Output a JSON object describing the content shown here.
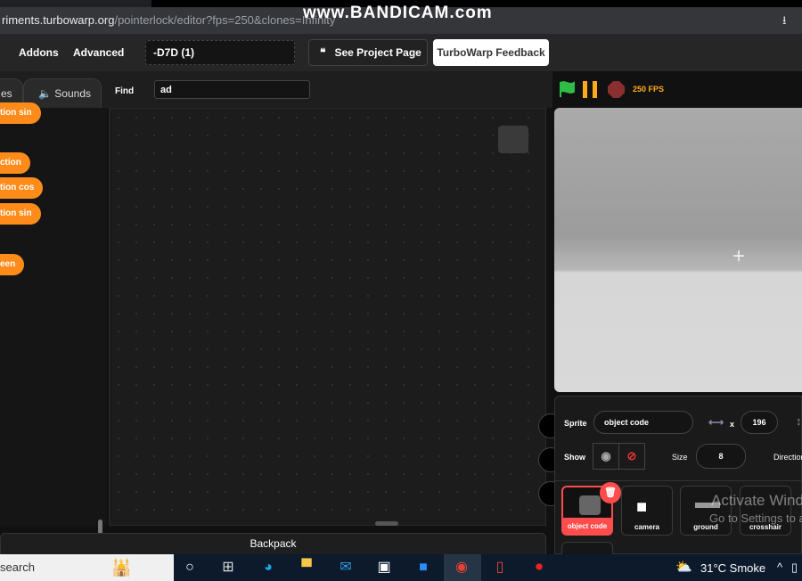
{
  "browser": {
    "url_host": "riments.turbowarp.org",
    "url_path": "/pointerlock/editor?fps=250&clones=Infinity",
    "watermark": "www.BANDICAM.com"
  },
  "menubar": {
    "items": [
      "Addons",
      "Advanced"
    ],
    "project_title": "-D7D (1)",
    "see_project": "See Project Page",
    "feedback": "TurboWarp Feedback"
  },
  "editor_tabs": {
    "costumes": "es",
    "sounds": "Sounds"
  },
  "find": {
    "label": "Find",
    "value": "ad"
  },
  "palette": {
    "blocks": [
      "tion sin",
      "ction",
      "tion cos",
      "tion sin",
      "een"
    ]
  },
  "backpack": "Backpack",
  "controls": {
    "fps": "250 FPS",
    "colors": {
      "flag": "#2ebd46",
      "pause": "#ffab19",
      "stop": "#8a2f2f"
    }
  },
  "sprite_info": {
    "sprite_label": "Sprite",
    "sprite_name": "object code",
    "x_label": "x",
    "x_value": "196",
    "show_label": "Show",
    "size_label": "Size",
    "size_value": "8",
    "direction_label": "Direction"
  },
  "sprites": [
    {
      "name": "object code",
      "selected": true
    },
    {
      "name": "camera"
    },
    {
      "name": "ground"
    },
    {
      "name": "crosshair"
    }
  ],
  "watermark_overlay": {
    "line1": "Activate Windows",
    "line2": "Go to Settings to activate Windows."
  },
  "taskbar": {
    "search": "search",
    "weather": "31°C  Smoke"
  }
}
